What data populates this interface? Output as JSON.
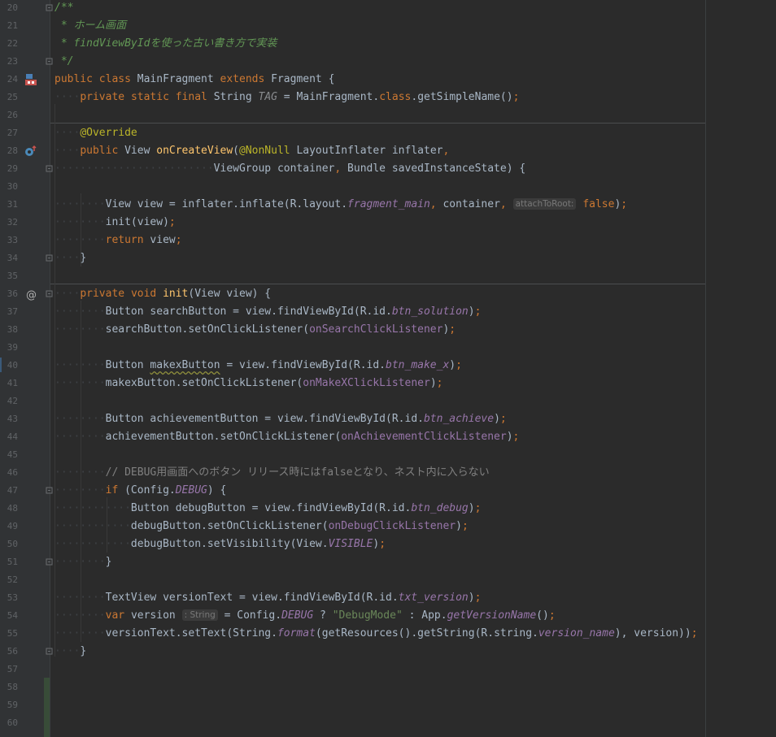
{
  "editor": {
    "line_numbers": [
      "20",
      "21",
      "22",
      "23",
      "24",
      "25",
      "26",
      "27",
      "28",
      "29",
      "30",
      "31",
      "32",
      "33",
      "34",
      "35",
      "36",
      "37",
      "38",
      "39",
      "40",
      "41",
      "42",
      "43",
      "44",
      "45",
      "46",
      "47",
      "48",
      "49",
      "50",
      "51",
      "52",
      "53",
      "54",
      "55",
      "56",
      "57",
      "58",
      "59",
      "60"
    ],
    "code": {
      "doc_open": "/**",
      "doc_line1": " * ホーム画面",
      "doc_line2": " * findViewByIdを使った古い書き方で実装",
      "doc_close": " */",
      "kw_public": "public",
      "kw_class": "class",
      "class_name": "MainFragment",
      "kw_extends": "extends",
      "super_name": "Fragment",
      "kw_private": "private",
      "kw_static": "static",
      "kw_final": "final",
      "type_string": "String",
      "field_tag": "TAG",
      "tag_init": "MainFragment.",
      "get_simple_name": "getSimpleName()",
      "annotation_override": "@Override",
      "type_view": "View",
      "method_on_create_view": "onCreateView",
      "annotation_nonnull": "@NonNull",
      "param_inflater": "LayoutInflater inflater",
      "param_container": "ViewGroup container",
      "param_bundle": "Bundle savedInstanceState) {",
      "inflate_call": "View view = inflater.inflate(R.layout.",
      "res_fragment_main": "fragment_main",
      "container_arg": "container",
      "hint_attach_to_root": "attachToRoot:",
      "kw_false": "false",
      "init_call": "init(view)",
      "kw_return": "return",
      "view_word": "view",
      "kw_void": "void",
      "method_init": "init",
      "init_params": "(View view) {",
      "button_type": "Button",
      "search_decl": "searchButton = view.findViewById(R.id.",
      "res_btn_solution": "btn_solution",
      "search_set": "searchButton.setOnClickListener(",
      "listener_search": "onSearchClickListener",
      "makex_var": "makexButton",
      "makex_decl": " = view.findViewById(R.id.",
      "res_btn_make_x": "btn_make_x",
      "makex_set": "makexButton.setOnClickListener(",
      "listener_makex": "onMakeXClickListener",
      "achieve_decl": "achievementButton = view.findViewById(R.id.",
      "res_btn_achieve": "btn_achieve",
      "achieve_set": "achievementButton.setOnClickListener(",
      "listener_achieve": "onAchievementClickListener",
      "comment_debug": "// DEBUG用画面へのボタン リリース時にはfalseとなり、ネスト内に入らない",
      "kw_if": "if",
      "config_open": "(Config.",
      "const_debug": "DEBUG",
      "debug_decl": "debugButton = view.findViewById(R.id.",
      "res_btn_debug": "btn_debug",
      "debug_set": "debugButton.setOnClickListener(",
      "listener_debug": "onDebugClickListener",
      "debug_visibility": "debugButton.setVisibility(View.",
      "const_visible": "VISIBLE",
      "version_decl": "TextView versionText = view.findViewById(R.id.",
      "res_txt_version": "txt_version",
      "kw_var": "var",
      "version_var": "version",
      "hint_string": ": String",
      "config_assign": " = Config.",
      "string_debug_mode": "\"DebugMode\"",
      "app_prefix": " : App.",
      "method_get_version_name": "getVersionName",
      "set_text_prefix": "versionText.setText(String.",
      "method_format": "format",
      "get_resources": "(getResources().getString(R.string.",
      "res_version_name": "version_name",
      "version_arg": "), version))"
    }
  },
  "colors": {
    "background": "#2b2b2b",
    "gutter": "#313335",
    "keyword": "#cc7832",
    "doc_comment": "#629755",
    "annotation": "#bbb529",
    "method_decl": "#ffc66d",
    "field_ref": "#9876aa",
    "string": "#6a8759",
    "text": "#a9b7c6",
    "line_number": "#606366"
  },
  "gutter_icons": [
    "class-hierarchy-icon",
    "override-method-icon",
    "at-sign-icon"
  ]
}
